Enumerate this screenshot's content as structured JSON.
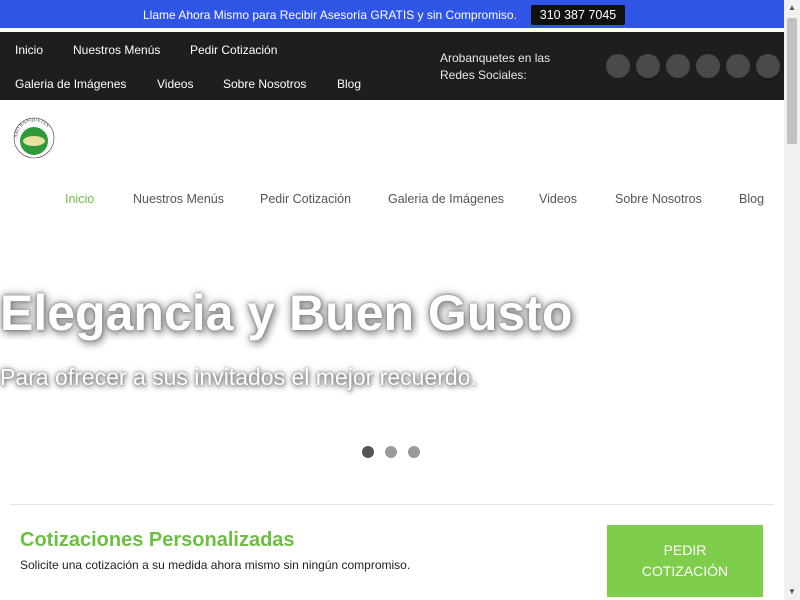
{
  "announcement": {
    "text": "Llame Ahora Mismo para Recibir Asesoría GRATIS y sin Compromiso.",
    "phone": "310 387 7045"
  },
  "top_nav": {
    "items": [
      "Inicio",
      "Nuestros Menús",
      "Pedir Cotización",
      "Galeria de Imágenes",
      "Videos",
      "Sobre Nosotros",
      "Blog"
    ],
    "social_label": "Arobanquetes en las Redes Sociales:",
    "social_icons": [
      "social-icon-1",
      "social-icon-2",
      "social-icon-3",
      "social-icon-4",
      "social-icon-5",
      "social-icon-6"
    ]
  },
  "logo": {
    "text": "ARO BANQUETES"
  },
  "main_nav": {
    "items": [
      "Inicio",
      "Nuestros Menús",
      "Pedir Cotización",
      "Galeria de Imágenes",
      "Videos",
      "Sobre Nosotros",
      "Blog"
    ],
    "active": "Inicio"
  },
  "hero": {
    "title": "Elegancia y Buen Gusto",
    "subtitle": "Para ofrecer a sus invitados el mejor recuerdo.",
    "slide_count": 3,
    "active_slide": 1
  },
  "cta": {
    "title": "Cotizaciones Personalizadas",
    "text": "Solicite una cotización a su medida ahora mismo sin ningún compromiso.",
    "button_line1": "PEDIR",
    "button_line2": "COTIZACIÓN"
  },
  "colors": {
    "announcement_bg": "#2f55e6",
    "nav_bg": "#1e1e1e",
    "accent_green": "#6cbf42",
    "button_green": "#7fce4b"
  }
}
